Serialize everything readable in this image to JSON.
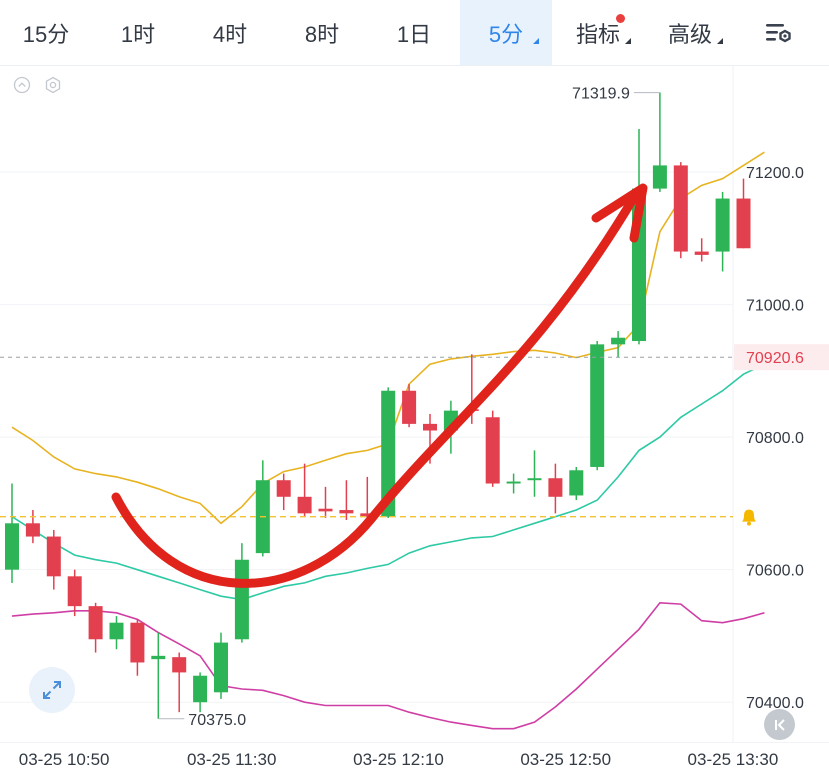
{
  "tabs": [
    {
      "label": "15分",
      "active": false
    },
    {
      "label": "1时",
      "active": false
    },
    {
      "label": "4时",
      "active": false
    },
    {
      "label": "8时",
      "active": false
    },
    {
      "label": "1日",
      "active": false
    },
    {
      "label": "5分",
      "active": true,
      "dropdown": true
    },
    {
      "label": "指标",
      "active": false,
      "dropdown": true,
      "notification_dot": true
    },
    {
      "label": "高级",
      "active": false,
      "dropdown": true
    }
  ],
  "icons": {
    "collapse": "chevron-up-circle-icon",
    "settings_small": "hexagon-settings-icon",
    "toolbar_settings": "list-settings-icon",
    "expand": "expand-arrows-icon",
    "kline": "skip-back-icon",
    "alert": "bell-icon"
  },
  "colors": {
    "up": "#2db456",
    "down": "#e2404f",
    "ma_fast": "#e8b320",
    "ma_slow": "#2ec9a5",
    "lower_band": "#cf3ea4",
    "annotation": "#e0231b",
    "active_tab": "#2f86e8",
    "price_label": "#e2404f"
  },
  "chart_data": {
    "type": "candlestick",
    "ylim": [
      70340,
      71360
    ],
    "y_ticks": [
      {
        "value": 71200,
        "label": "71200.0"
      },
      {
        "value": 71000,
        "label": "71000.0"
      },
      {
        "value": 70800,
        "label": "70800.0"
      },
      {
        "value": 70600,
        "label": "70600.0"
      },
      {
        "value": 70400,
        "label": "70400.0"
      }
    ],
    "x_ticks": [
      {
        "index": 2.5,
        "label": "03-25 10:50"
      },
      {
        "index": 10.5,
        "label": "03-25 11:30"
      },
      {
        "index": 18.5,
        "label": "03-25 12:10"
      },
      {
        "index": 26.5,
        "label": "03-25 12:50"
      },
      {
        "index": 34.5,
        "label": "03-25 13:30"
      }
    ],
    "current_price": {
      "value": 70920.6,
      "label": "70920.6"
    },
    "alert_price": 70680,
    "high_marker": {
      "index": 31,
      "value": 71319.9,
      "label": "71319.9"
    },
    "low_marker": {
      "index": 7,
      "value": 70375.0,
      "label": "70375.0"
    },
    "candles": [
      {
        "o": 70600,
        "h": 70730,
        "l": 70580,
        "c": 70670
      },
      {
        "o": 70670,
        "h": 70690,
        "l": 70640,
        "c": 70650
      },
      {
        "o": 70650,
        "h": 70660,
        "l": 70570,
        "c": 70590
      },
      {
        "o": 70590,
        "h": 70600,
        "l": 70530,
        "c": 70545
      },
      {
        "o": 70545,
        "h": 70550,
        "l": 70475,
        "c": 70495
      },
      {
        "o": 70495,
        "h": 70530,
        "l": 70480,
        "c": 70520
      },
      {
        "o": 70520,
        "h": 70525,
        "l": 70440,
        "c": 70460
      },
      {
        "o": 70465,
        "h": 70505,
        "l": 70375,
        "c": 70470
      },
      {
        "o": 70468,
        "h": 70475,
        "l": 70385,
        "c": 70445
      },
      {
        "o": 70400,
        "h": 70445,
        "l": 70385,
        "c": 70440
      },
      {
        "o": 70415,
        "h": 70505,
        "l": 70405,
        "c": 70490
      },
      {
        "o": 70495,
        "h": 70640,
        "l": 70490,
        "c": 70615
      },
      {
        "o": 70625,
        "h": 70765,
        "l": 70620,
        "c": 70735
      },
      {
        "o": 70735,
        "h": 70745,
        "l": 70690,
        "c": 70710
      },
      {
        "o": 70710,
        "h": 70760,
        "l": 70680,
        "c": 70685
      },
      {
        "o": 70692,
        "h": 70725,
        "l": 70678,
        "c": 70688
      },
      {
        "o": 70690,
        "h": 70735,
        "l": 70675,
        "c": 70685
      },
      {
        "o": 70685,
        "h": 70740,
        "l": 70675,
        "c": 70680
      },
      {
        "o": 70680,
        "h": 70875,
        "l": 70678,
        "c": 70870
      },
      {
        "o": 70870,
        "h": 70880,
        "l": 70815,
        "c": 70820
      },
      {
        "o": 70820,
        "h": 70835,
        "l": 70760,
        "c": 70810
      },
      {
        "o": 70810,
        "h": 70855,
        "l": 70775,
        "c": 70840
      },
      {
        "o": 70842,
        "h": 70925,
        "l": 70820,
        "c": 70840
      },
      {
        "o": 70830,
        "h": 70840,
        "l": 70725,
        "c": 70730
      },
      {
        "o": 70730,
        "h": 70745,
        "l": 70715,
        "c": 70733
      },
      {
        "o": 70735,
        "h": 70780,
        "l": 70710,
        "c": 70738
      },
      {
        "o": 70738,
        "h": 70760,
        "l": 70685,
        "c": 70710
      },
      {
        "o": 70712,
        "h": 70755,
        "l": 70705,
        "c": 70750
      },
      {
        "o": 70755,
        "h": 70945,
        "l": 70750,
        "c": 70940
      },
      {
        "o": 70940,
        "h": 70960,
        "l": 70920,
        "c": 70950
      },
      {
        "o": 70945,
        "h": 71265,
        "l": 70940,
        "c": 71175
      },
      {
        "o": 71175,
        "h": 71320,
        "l": 71170,
        "c": 71210
      },
      {
        "o": 71210,
        "h": 71215,
        "l": 71070,
        "c": 71080
      },
      {
        "o": 71080,
        "h": 71100,
        "l": 71065,
        "c": 71075
      },
      {
        "o": 71080,
        "h": 71170,
        "l": 71050,
        "c": 71160
      },
      {
        "o": 71160,
        "h": 71190,
        "l": 71085,
        "c": 71085
      }
    ],
    "ma_fast": [
      70815,
      70795,
      70770,
      70752,
      70745,
      70740,
      70732,
      70722,
      70710,
      70700,
      70670,
      70695,
      70730,
      70748,
      70755,
      70765,
      70775,
      70780,
      70790,
      70880,
      70910,
      70918,
      70922,
      70925,
      70929,
      70931,
      70927,
      70920,
      70928,
      70935,
      70970,
      71110,
      71160,
      71180,
      71190,
      71210,
      71230
    ],
    "ma_slow": [
      70680,
      70660,
      70640,
      70622,
      70615,
      70610,
      70600,
      70590,
      70580,
      70570,
      70560,
      70555,
      70565,
      70575,
      70580,
      70590,
      70595,
      70602,
      70608,
      70625,
      70636,
      70642,
      70648,
      70650,
      70660,
      70670,
      70680,
      70690,
      70705,
      70740,
      70780,
      70800,
      70830,
      70850,
      70870,
      70895,
      70910
    ],
    "lower_band": [
      70530,
      70533,
      70535,
      70538,
      70538,
      70535,
      70525,
      70505,
      70488,
      70470,
      70425,
      70420,
      70418,
      70410,
      70400,
      70395,
      70395,
      70395,
      70395,
      70385,
      70377,
      70370,
      70365,
      70360,
      70360,
      70370,
      70393,
      70420,
      70450,
      70480,
      70510,
      70550,
      70548,
      70523,
      70520,
      70526,
      70535
    ]
  }
}
